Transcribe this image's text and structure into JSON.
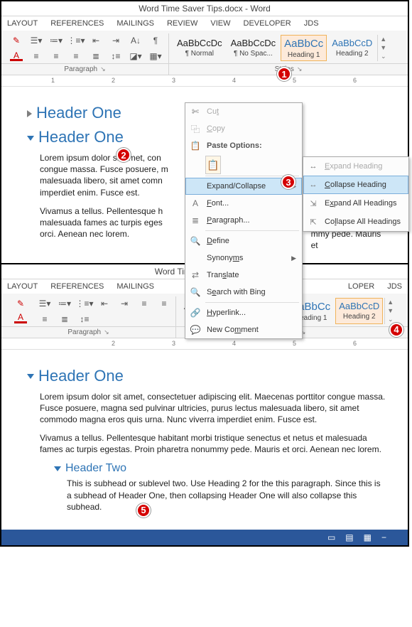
{
  "title": "Word Time Saver Tips.docx - Word",
  "title2": "Word Time Saver Tips.doc",
  "tabs": [
    "LAYOUT",
    "REFERENCES",
    "MAILINGS",
    "REVIEW",
    "VIEW",
    "DEVELOPER",
    "JDS"
  ],
  "tabs2": [
    "LAYOUT",
    "REFERENCES",
    "MAILINGS",
    "",
    "",
    "",
    "LOPER",
    "JDS"
  ],
  "group_paragraph": "Paragraph",
  "group_styles": "Styles",
  "styles": [
    {
      "sample": "AaBbCcDc",
      "name": "¶ Normal"
    },
    {
      "sample": "AaBbCcDc",
      "name": "¶ No Spac..."
    },
    {
      "sample": "AaBbCc",
      "name": "Heading 1",
      "blue": true
    },
    {
      "sample": "AaBbCcD",
      "name": "Heading 2",
      "blue": true
    }
  ],
  "ruler_ticks": [
    "1",
    "2",
    "3",
    "4",
    "5",
    "6"
  ],
  "doc": {
    "h1a": "Header One",
    "h1b": "Header One",
    "p1": "Lorem ipsum dolor sit amet, consectetuer adipiscing elit. Maecenas porttitor congue massa. Fusce posuere, magna sed pulvinar ultricies, purus lectus malesuada libero, sit amet commodo magna eros quis urna. Nunc viverra imperdiet enim. Fusce est.",
    "p1_cut": "Lorem ipsum dolor sit amet, con\ncongue massa. Fusce posuere, m\nmalesuada libero, sit amet comn\nimperdiet enim. Fusce est.",
    "p2": "Vivamus a tellus. Pellentesque habitant morbi tristique senectus et netus et malesuada fames ac turpis egestas. Proin pharetra nonummy pede. Mauris et orci. Aenean nec lorem.",
    "p2_cut_l": "Vivamus a tellus. Pellentesque h\nmalesuada fames ac turpis eges\norci. Aenean nec lorem.",
    "p2_cut_r": "senectus et netus et\nmmy pede. Mauris et",
    "h2": "Header Two",
    "p3": "This is subhead or sublevel two. Use Heading 2 for the this paragraph. Since this is a subhead of Header One, then collapsing Header One will also collapse this subhead."
  },
  "context_menu": {
    "cut": "Cut",
    "copy": "Copy",
    "paste_options": "Paste Options:",
    "expand_collapse": "Expand/Collapse",
    "font": "Font...",
    "paragraph": "Paragraph...",
    "define": "Define",
    "synonyms": "Synonyms",
    "translate": "Translate",
    "search_bing": "Search with Bing",
    "hyperlink": "Hyperlink...",
    "new_comment": "New Comment"
  },
  "sub_menu": {
    "expand_heading": "Expand Heading",
    "collapse_heading": "Collapse Heading",
    "expand_all": "Expand All Headings",
    "collapse_all": "Collapse All Headings"
  },
  "callouts": {
    "c1": "1",
    "c2": "2",
    "c3": "3",
    "c4": "4",
    "c5": "5"
  }
}
